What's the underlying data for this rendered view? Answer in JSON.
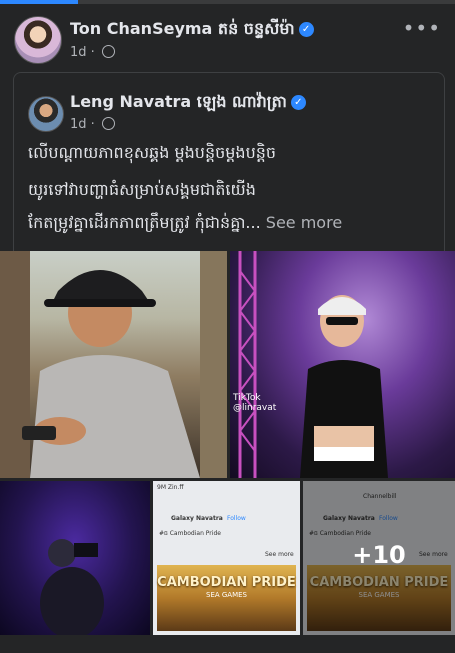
{
  "post": {
    "author": "Ton  ChanSeyma តន់ ចន្ទសីម៉ា",
    "time": "1d",
    "more": "•••"
  },
  "shared": {
    "author": "Leng Navatra   ឡេង ណាវ៉ាត្រា",
    "time": "1d",
    "caption_line1": "លើបណ្ដាយភាពខុសឆ្គង ម្ដងបន្តិចម្ដងបន្តិច",
    "caption_line2": "យូរទៅវាបញ្ហាធំសម្រាប់សង្គមជាតិយើង",
    "caption_line3": "កែតម្រូវគ្នាដើរកភាពត្រឹមត្រូវ កុំជាន់គ្នា...",
    "see_more": "See more"
  },
  "media": {
    "tiktok_brand": "TikTok",
    "tiktok_handle": "@linravat",
    "plus_more": "+10",
    "mini_name": "Galaxy Navatra",
    "mini_follow": "Follow",
    "mini_post": "#ធ Cambodian Pride",
    "mini_see_more": "See more",
    "mini_views": "9M Zin.ff",
    "banner_title": "CAMBODIAN PRIDE",
    "banner_sub": "SEA GAMES",
    "mini_topname": "Channelbill"
  },
  "colors": {
    "background": "#242526",
    "accent": "#2d88ff",
    "text_primary": "#e4e6eb",
    "text_secondary": "#b0b3b8"
  },
  "icons": {
    "verified": "verified-check-icon",
    "audience": "globe-icon",
    "more": "more-dots-icon"
  }
}
